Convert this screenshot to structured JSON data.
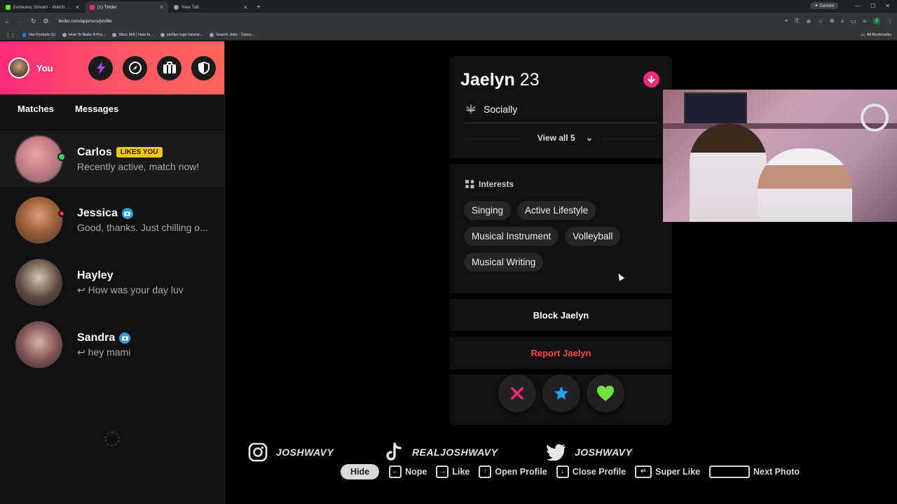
{
  "browser": {
    "tabs": [
      {
        "title": "joshwavy Stream - Watch Live o",
        "color": "#53fc18",
        "active": false
      },
      {
        "title": "(1) Tinder",
        "color": "#fd267a",
        "active": true
      },
      {
        "title": "New Tab",
        "color": "#9aa0a6",
        "active": false
      }
    ],
    "url": "tinder.com/app/recs/profile",
    "gemini_label": "Gemini",
    "profile_initial": "J",
    "bookmarks": [
      "Hot Pockets (1)",
      "How To Make A Pro...",
      "Xbox 360 | How to...",
      "skrillex logo tutorial...",
      "Search Jobs - Caree..."
    ],
    "all_bookmarks": "All Bookmarks"
  },
  "sidebar": {
    "user_label": "You",
    "header_icons": [
      "bolt-icon",
      "compass-icon",
      "briefcase-icon",
      "shield-icon"
    ],
    "tabs": [
      {
        "label": "Matches",
        "active": false
      },
      {
        "label": "Messages",
        "active": true
      }
    ],
    "messages": [
      {
        "name": "Carlos",
        "badge": "LIKES YOU",
        "preview": "Recently active, match now!",
        "status": "online"
      },
      {
        "name": "Jessica",
        "verified": true,
        "preview": "Good, thanks. Just chilling o...",
        "status": "unread"
      },
      {
        "name": "Hayley",
        "verified": false,
        "preview": "How was your day luv",
        "replied": true
      },
      {
        "name": "Sandra",
        "verified": true,
        "preview": "hey mami",
        "replied": true
      }
    ]
  },
  "profile": {
    "name": "Jaelyn",
    "age": "23",
    "lifestyle_value": "Socially",
    "view_all": "View all 5",
    "interests_title": "Interests",
    "interests": [
      "Singing",
      "Active Lifestyle",
      "Musical Instrument",
      "Volleyball",
      "Musical Writing"
    ],
    "block_label": "Block Jaelyn",
    "report_label": "Report Jaelyn",
    "colors": {
      "accent": "#fd267a",
      "report": "#fd4b4b",
      "star": "#1ea5ff",
      "like": "#6fe33c"
    }
  },
  "socials": [
    {
      "icon": "instagram-icon",
      "handle": "JOSHWAVY"
    },
    {
      "icon": "tiktok-icon",
      "handle": "REALJOSHWAVY"
    },
    {
      "icon": "twitter-icon",
      "handle": "JOSHWAVY"
    }
  ],
  "hints": {
    "hide": "Hide",
    "items": [
      "Nope",
      "Like",
      "Open Profile",
      "Close Profile",
      "Super Like",
      "Next Photo"
    ]
  }
}
